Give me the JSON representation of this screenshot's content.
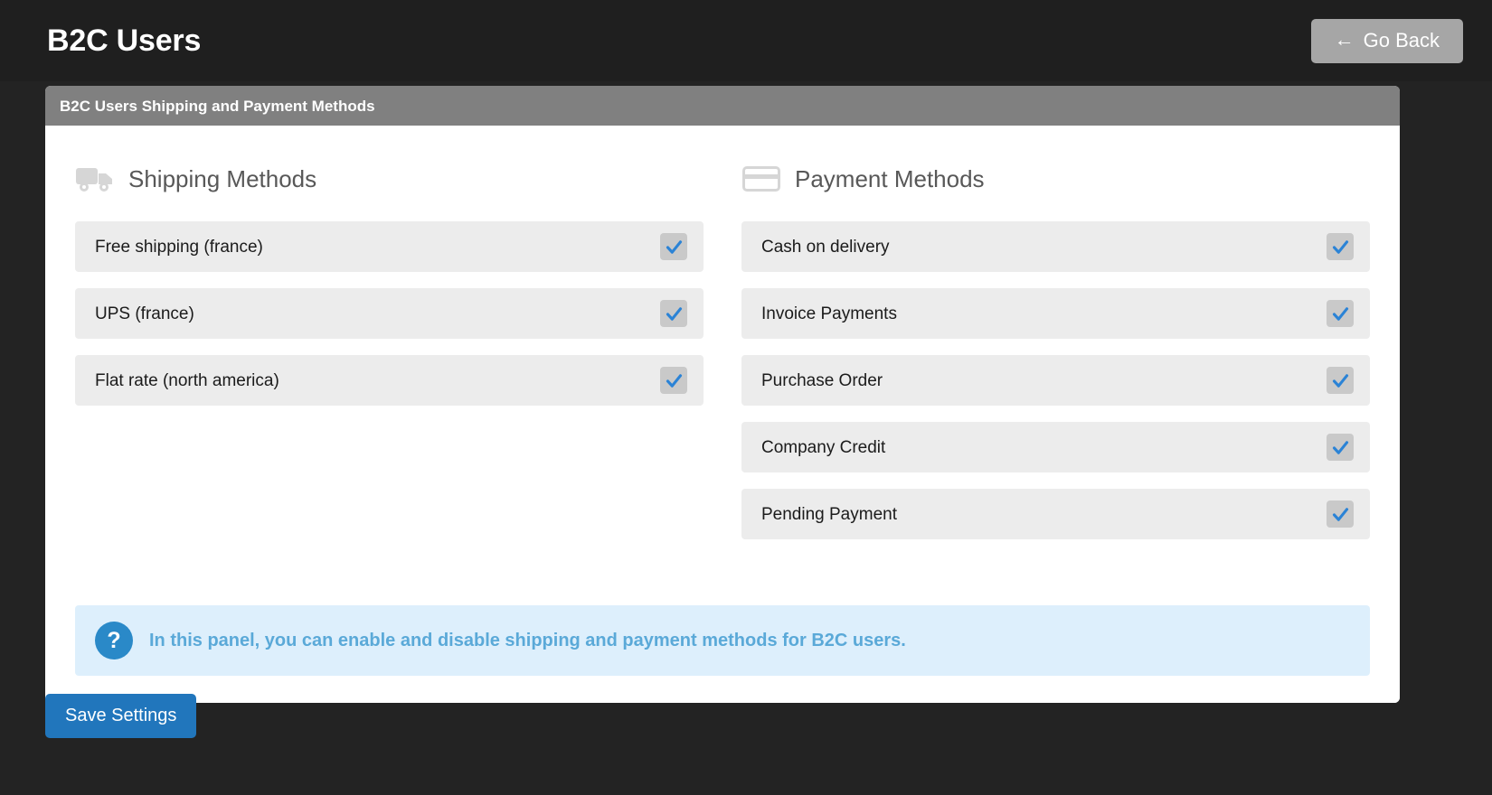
{
  "header": {
    "title": "B2C Users",
    "go_back_label": "Go Back",
    "go_back_arrow": "←",
    "back_icon_name": "arrow-left-icon"
  },
  "card": {
    "title": "B2C Users Shipping and Payment Methods"
  },
  "shipping": {
    "icon_name": "truck-icon",
    "title": "Shipping Methods",
    "items": [
      {
        "label": "Free shipping (france)",
        "checked": true
      },
      {
        "label": "UPS (france)",
        "checked": true
      },
      {
        "label": "Flat rate (north america)",
        "checked": true
      }
    ]
  },
  "payment": {
    "icon_name": "credit-card-icon",
    "title": "Payment Methods",
    "items": [
      {
        "label": "Cash on delivery",
        "checked": true
      },
      {
        "label": "Invoice Payments",
        "checked": true
      },
      {
        "label": "Purchase Order",
        "checked": true
      },
      {
        "label": "Company Credit",
        "checked": true
      },
      {
        "label": "Pending Payment",
        "checked": true
      }
    ]
  },
  "info": {
    "icon_name": "question-mark-icon",
    "icon_glyph": "?",
    "text": "In this panel, you can enable and disable shipping and payment methods for B2C users."
  },
  "footer": {
    "save_label": "Save Settings"
  },
  "colors": {
    "page_background": "#232323",
    "topbar_background": "#1f1f1f",
    "card_header": "#808080",
    "row_background": "#ececec",
    "checkbox_background": "#c9c9c9",
    "checkmark": "#2b83d6",
    "info_background": "#ddeffc",
    "info_text": "#5aa9d8",
    "info_icon": "#2a89c8",
    "save_button": "#2176bc",
    "go_back_button": "#a6a6a6",
    "section_icon": "#d4d4d4",
    "section_title": "#585858"
  }
}
